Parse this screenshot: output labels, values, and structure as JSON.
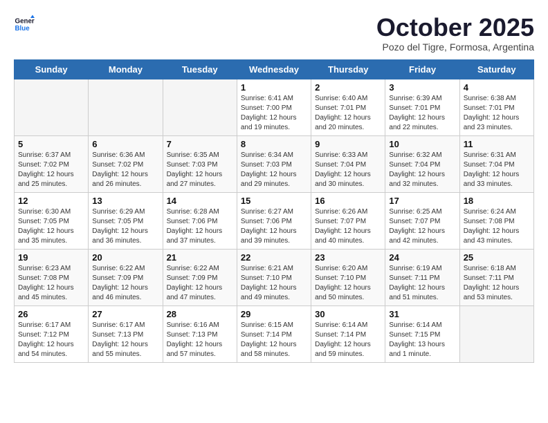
{
  "logo": {
    "line1": "General",
    "line2": "Blue"
  },
  "title": "October 2025",
  "subtitle": "Pozo del Tigre, Formosa, Argentina",
  "days_of_week": [
    "Sunday",
    "Monday",
    "Tuesday",
    "Wednesday",
    "Thursday",
    "Friday",
    "Saturday"
  ],
  "weeks": [
    [
      {
        "day": "",
        "info": ""
      },
      {
        "day": "",
        "info": ""
      },
      {
        "day": "",
        "info": ""
      },
      {
        "day": "1",
        "info": "Sunrise: 6:41 AM\nSunset: 7:00 PM\nDaylight: 12 hours and 19 minutes."
      },
      {
        "day": "2",
        "info": "Sunrise: 6:40 AM\nSunset: 7:01 PM\nDaylight: 12 hours and 20 minutes."
      },
      {
        "day": "3",
        "info": "Sunrise: 6:39 AM\nSunset: 7:01 PM\nDaylight: 12 hours and 22 minutes."
      },
      {
        "day": "4",
        "info": "Sunrise: 6:38 AM\nSunset: 7:01 PM\nDaylight: 12 hours and 23 minutes."
      }
    ],
    [
      {
        "day": "5",
        "info": "Sunrise: 6:37 AM\nSunset: 7:02 PM\nDaylight: 12 hours and 25 minutes."
      },
      {
        "day": "6",
        "info": "Sunrise: 6:36 AM\nSunset: 7:02 PM\nDaylight: 12 hours and 26 minutes."
      },
      {
        "day": "7",
        "info": "Sunrise: 6:35 AM\nSunset: 7:03 PM\nDaylight: 12 hours and 27 minutes."
      },
      {
        "day": "8",
        "info": "Sunrise: 6:34 AM\nSunset: 7:03 PM\nDaylight: 12 hours and 29 minutes."
      },
      {
        "day": "9",
        "info": "Sunrise: 6:33 AM\nSunset: 7:04 PM\nDaylight: 12 hours and 30 minutes."
      },
      {
        "day": "10",
        "info": "Sunrise: 6:32 AM\nSunset: 7:04 PM\nDaylight: 12 hours and 32 minutes."
      },
      {
        "day": "11",
        "info": "Sunrise: 6:31 AM\nSunset: 7:04 PM\nDaylight: 12 hours and 33 minutes."
      }
    ],
    [
      {
        "day": "12",
        "info": "Sunrise: 6:30 AM\nSunset: 7:05 PM\nDaylight: 12 hours and 35 minutes."
      },
      {
        "day": "13",
        "info": "Sunrise: 6:29 AM\nSunset: 7:05 PM\nDaylight: 12 hours and 36 minutes."
      },
      {
        "day": "14",
        "info": "Sunrise: 6:28 AM\nSunset: 7:06 PM\nDaylight: 12 hours and 37 minutes."
      },
      {
        "day": "15",
        "info": "Sunrise: 6:27 AM\nSunset: 7:06 PM\nDaylight: 12 hours and 39 minutes."
      },
      {
        "day": "16",
        "info": "Sunrise: 6:26 AM\nSunset: 7:07 PM\nDaylight: 12 hours and 40 minutes."
      },
      {
        "day": "17",
        "info": "Sunrise: 6:25 AM\nSunset: 7:07 PM\nDaylight: 12 hours and 42 minutes."
      },
      {
        "day": "18",
        "info": "Sunrise: 6:24 AM\nSunset: 7:08 PM\nDaylight: 12 hours and 43 minutes."
      }
    ],
    [
      {
        "day": "19",
        "info": "Sunrise: 6:23 AM\nSunset: 7:08 PM\nDaylight: 12 hours and 45 minutes."
      },
      {
        "day": "20",
        "info": "Sunrise: 6:22 AM\nSunset: 7:09 PM\nDaylight: 12 hours and 46 minutes."
      },
      {
        "day": "21",
        "info": "Sunrise: 6:22 AM\nSunset: 7:09 PM\nDaylight: 12 hours and 47 minutes."
      },
      {
        "day": "22",
        "info": "Sunrise: 6:21 AM\nSunset: 7:10 PM\nDaylight: 12 hours and 49 minutes."
      },
      {
        "day": "23",
        "info": "Sunrise: 6:20 AM\nSunset: 7:10 PM\nDaylight: 12 hours and 50 minutes."
      },
      {
        "day": "24",
        "info": "Sunrise: 6:19 AM\nSunset: 7:11 PM\nDaylight: 12 hours and 51 minutes."
      },
      {
        "day": "25",
        "info": "Sunrise: 6:18 AM\nSunset: 7:11 PM\nDaylight: 12 hours and 53 minutes."
      }
    ],
    [
      {
        "day": "26",
        "info": "Sunrise: 6:17 AM\nSunset: 7:12 PM\nDaylight: 12 hours and 54 minutes."
      },
      {
        "day": "27",
        "info": "Sunrise: 6:17 AM\nSunset: 7:13 PM\nDaylight: 12 hours and 55 minutes."
      },
      {
        "day": "28",
        "info": "Sunrise: 6:16 AM\nSunset: 7:13 PM\nDaylight: 12 hours and 57 minutes."
      },
      {
        "day": "29",
        "info": "Sunrise: 6:15 AM\nSunset: 7:14 PM\nDaylight: 12 hours and 58 minutes."
      },
      {
        "day": "30",
        "info": "Sunrise: 6:14 AM\nSunset: 7:14 PM\nDaylight: 12 hours and 59 minutes."
      },
      {
        "day": "31",
        "info": "Sunrise: 6:14 AM\nSunset: 7:15 PM\nDaylight: 13 hours and 1 minute."
      },
      {
        "day": "",
        "info": ""
      }
    ]
  ]
}
